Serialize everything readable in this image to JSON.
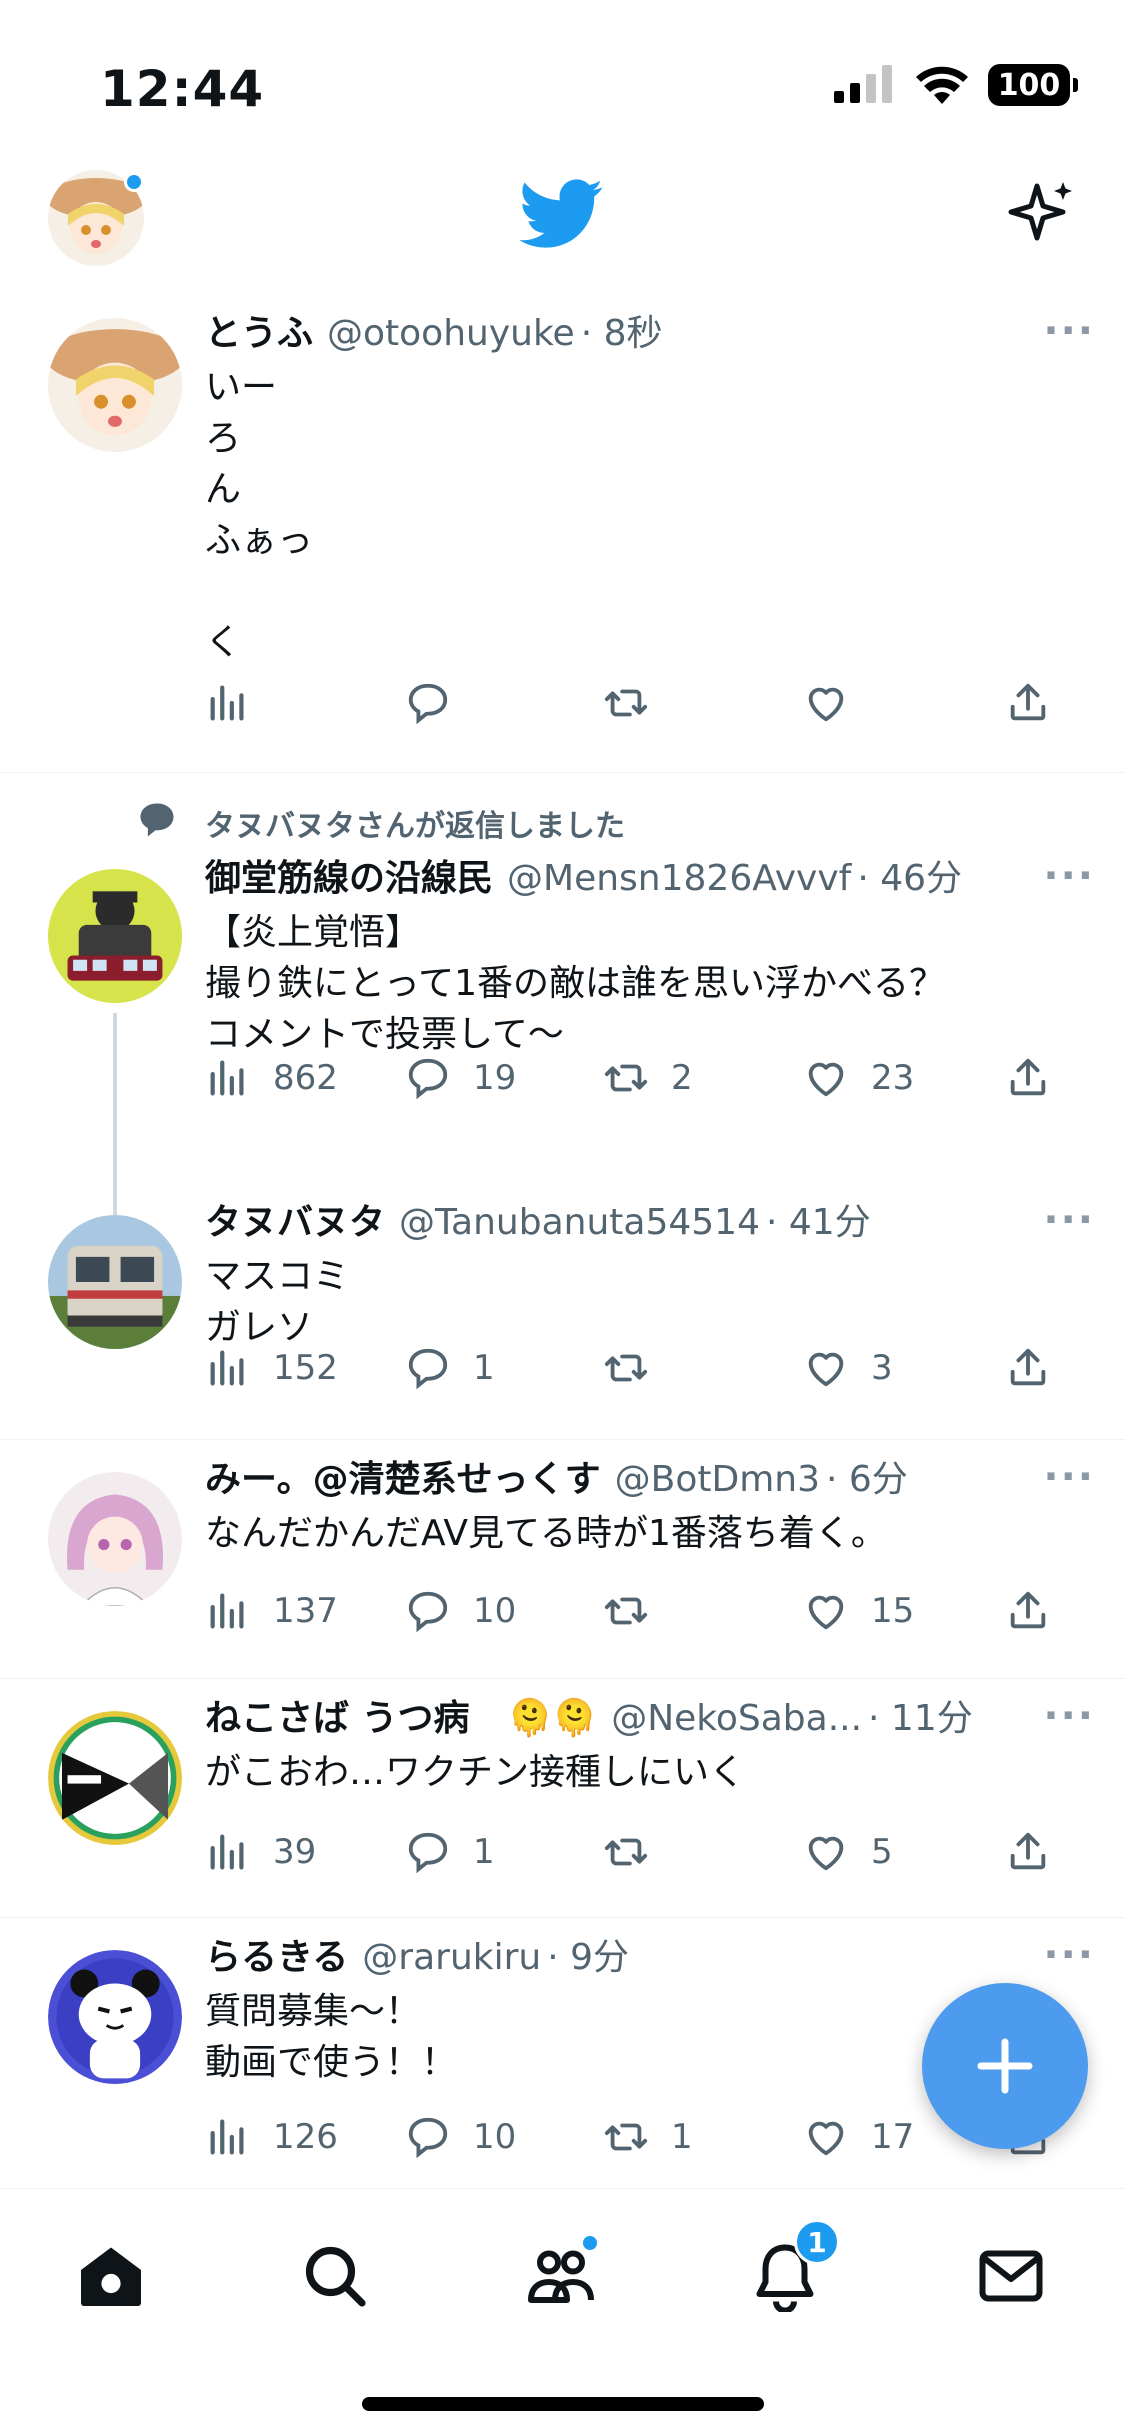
{
  "status_bar": {
    "time": "12:44",
    "battery": "100"
  },
  "header": {
    "logo": "twitter-bird-icon",
    "sparkle": "sparkle-icon"
  },
  "colors": {
    "accent": "#1d9bf0",
    "fab": "#4c9bee",
    "muted": "#536471"
  },
  "tweets": [
    {
      "name": "とうふ",
      "handle": "@otoohuyuke",
      "time": "· 8秒",
      "text": "いー\nろ\nん\nふぁっ\n\nく",
      "views": "",
      "replies": "",
      "retweets": "",
      "likes": ""
    },
    {
      "context": "タヌバヌタさんが返信しました",
      "name": "御堂筋線の沿線民",
      "handle": "@Mensn1826Avvvf",
      "time": "· 46分",
      "text": "【炎上覚悟】\n撮り鉄にとって1番の敵は誰を思い浮かべる？\nコメントで投票して〜",
      "views": "862",
      "replies": "19",
      "retweets": "2",
      "likes": "23"
    },
    {
      "name": "タヌバヌタ",
      "handle": "@Tanubanuta54514",
      "time": "· 41分",
      "text": "マスコミ\nガレソ",
      "views": "152",
      "replies": "1",
      "retweets": "",
      "likes": "3"
    },
    {
      "name": "みー。@清楚系せっくす",
      "handle": "@BotDmn3",
      "time": "· 6分",
      "text": "なんだかんだAV見てる時が1番落ち着く。",
      "views": "137",
      "replies": "10",
      "retweets": "",
      "likes": "15"
    },
    {
      "name": "ねこさば うつ病",
      "emoji": "🫠🫠",
      "handle": "@NekoSaba...",
      "time": "· 11分",
      "text": "がこおわ…ワクチン接種しにいく",
      "views": "39",
      "replies": "1",
      "retweets": "",
      "likes": "5"
    },
    {
      "name": "らるきる",
      "handle": "@rarukiru",
      "time": "· 9分",
      "text": "質問募集〜！\n動画で使う！！",
      "views": "126",
      "replies": "10",
      "retweets": "1",
      "likes": "17"
    }
  ],
  "tabbar": {
    "items": [
      "home-icon",
      "search-icon",
      "communities-icon",
      "notifications-icon",
      "messages-icon"
    ],
    "notifications_badge": "1"
  }
}
